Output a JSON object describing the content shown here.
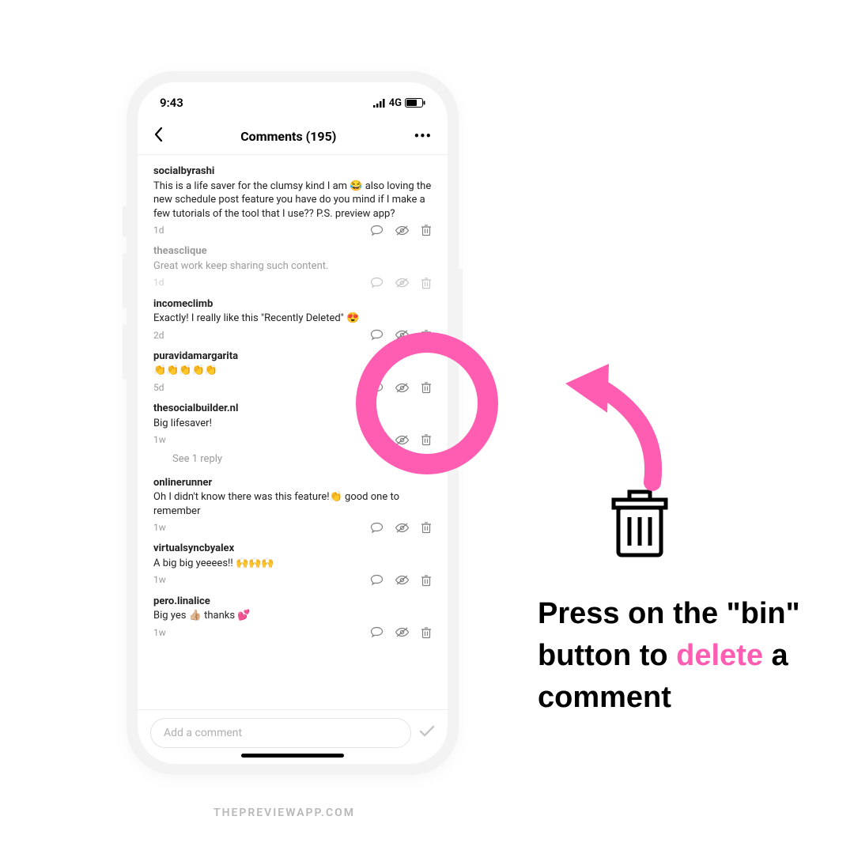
{
  "status": {
    "time": "9:43",
    "network": "4G"
  },
  "nav": {
    "title": "Comments (195)"
  },
  "comments": [
    {
      "user": "socialbyrashi",
      "text": "This is a life saver for the clumsy kind I am 😂 also loving the new schedule post feature you have do you mind if I make a few tutorials of the tool that I use?? P.S. preview app?",
      "time": "1d",
      "faded": false
    },
    {
      "user": "theasclique",
      "text": "Great work keep sharing such content.",
      "time": "1d",
      "faded": true
    },
    {
      "user": "incomeclimb",
      "text": "Exactly! I really like this \"Recently Deleted\" 😍",
      "time": "2d",
      "faded": false
    },
    {
      "user": "puravidamargarita",
      "text": "👏👏👏👏👏",
      "time": "5d",
      "faded": false
    },
    {
      "user": "thesocialbuilder.nl",
      "text": "Big lifesaver!",
      "time": "1w",
      "faded": false,
      "reply": "See 1 reply"
    },
    {
      "user": "onlinerunner",
      "text": "Oh I didn't know there was this feature!👏 good one to remember",
      "time": "1w",
      "faded": false
    },
    {
      "user": "virtualsyncbyalex",
      "text": "A big big yeeees!! 🙌🙌🙌",
      "time": "1w",
      "faded": false
    },
    {
      "user": "pero.linalice",
      "text": "Big yes 👍🏼 thanks 💕",
      "time": "1w",
      "faded": false
    }
  ],
  "input": {
    "placeholder": "Add a comment"
  },
  "caption": {
    "pre": "Press on the \"bin\" button to ",
    "highlight": "delete",
    "post": " a comment"
  },
  "watermark": "THEPREVIEWAPP.COM",
  "colors": {
    "accent": "#ff5db1"
  }
}
